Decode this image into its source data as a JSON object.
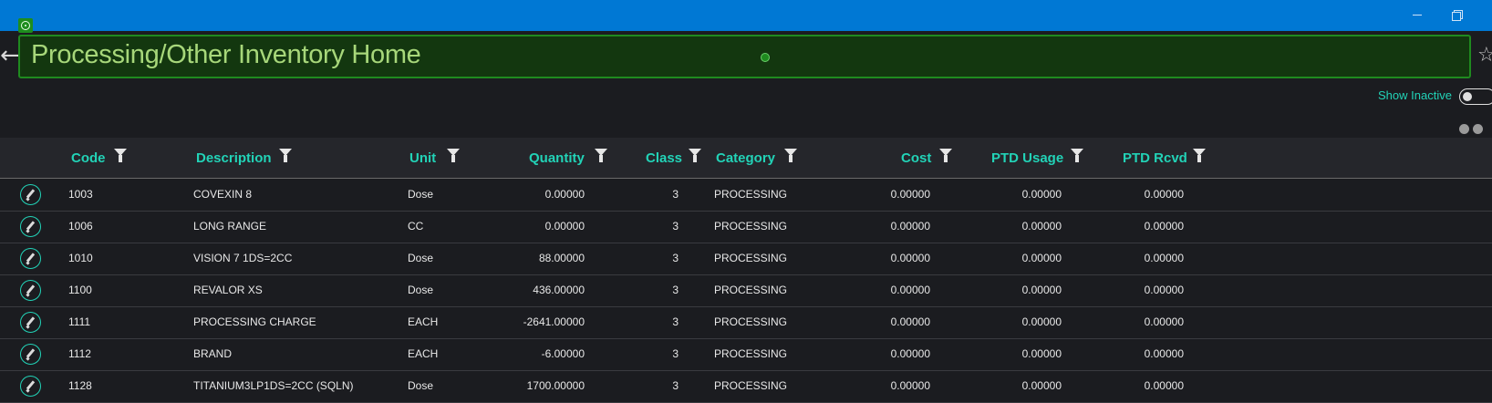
{
  "window": {
    "minimize_icon": "minimize-icon",
    "restore_icon": "restore-icon",
    "titlebar_color": "#0078d4"
  },
  "header": {
    "title": "Processing/Other Inventory Home",
    "back_icon": "back-arrow-icon",
    "favorite_icon": "star-icon",
    "accent_color": "#1f8a1f"
  },
  "controls": {
    "show_inactive_label": "Show Inactive",
    "show_inactive_on": false
  },
  "table": {
    "columns": [
      "Code",
      "Description",
      "Unit",
      "Quantity",
      "Class",
      "Category",
      "Cost",
      "PTD Usage",
      "PTD Rcvd"
    ],
    "rows": [
      [
        "1003",
        "COVEXIN 8",
        "Dose",
        "0.00000",
        "3",
        "PROCESSING",
        "0.00000",
        "0.00000",
        "0.00000"
      ],
      [
        "1006",
        "LONG RANGE",
        "CC",
        "0.00000",
        "3",
        "PROCESSING",
        "0.00000",
        "0.00000",
        "0.00000"
      ],
      [
        "1010",
        "VISION 7 1DS=2CC",
        "Dose",
        "88.00000",
        "3",
        "PROCESSING",
        "0.00000",
        "0.00000",
        "0.00000"
      ],
      [
        "1100",
        "REVALOR XS",
        "Dose",
        "436.00000",
        "3",
        "PROCESSING",
        "0.00000",
        "0.00000",
        "0.00000"
      ],
      [
        "1111",
        "PROCESSING CHARGE",
        "EACH",
        "-2641.00000",
        "3",
        "PROCESSING",
        "0.00000",
        "0.00000",
        "0.00000"
      ],
      [
        "1112",
        "BRAND",
        "EACH",
        "-6.00000",
        "3",
        "PROCESSING",
        "0.00000",
        "0.00000",
        "0.00000"
      ],
      [
        "1128",
        "TITANIUM3LP1DS=2CC (SQLN)",
        "Dose",
        "1700.00000",
        "3",
        "PROCESSING",
        "0.00000",
        "0.00000",
        "0.00000"
      ]
    ],
    "header_color": "#22d3b7"
  }
}
